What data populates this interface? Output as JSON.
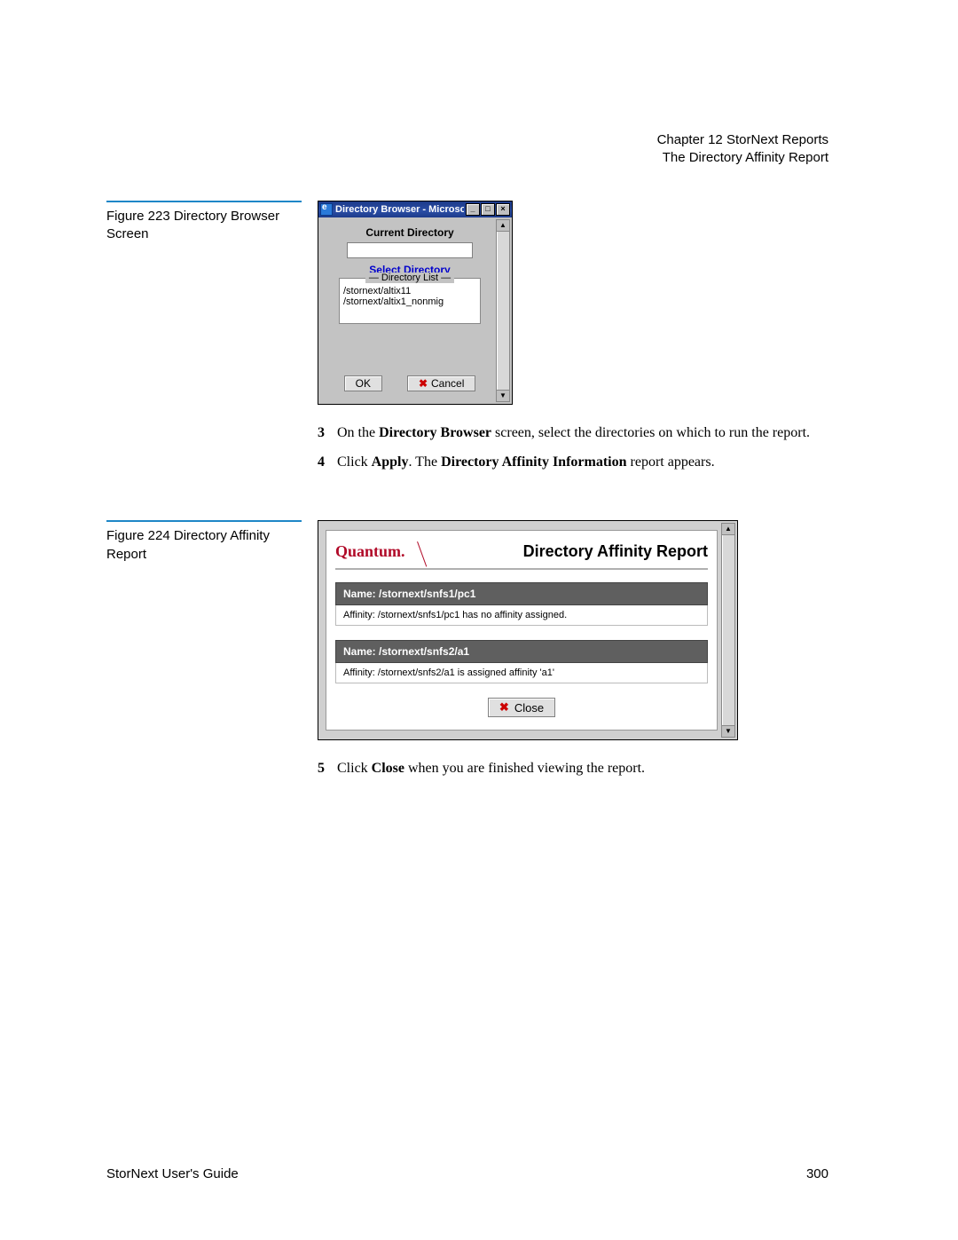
{
  "header": {
    "chapter": "Chapter 12  StorNext Reports",
    "section": "The Directory Affinity Report"
  },
  "figure1": {
    "caption": "Figure 223  Directory Browser Screen",
    "window_title": "Directory Browser - Microsoft Int...",
    "current_dir_label": "Current Directory",
    "select_dir_label": "Select Directory",
    "list_legend": "Directory List",
    "items": [
      "/stornext/altix11",
      "/stornext/altix1_nonmig"
    ],
    "ok_label": "OK",
    "cancel_label": "Cancel"
  },
  "steps_a": [
    {
      "num": "3",
      "pre": "On the ",
      "b1": "Directory Browser",
      "mid": " screen, select the directories on which to run the report."
    },
    {
      "num": "4",
      "pre": "Click ",
      "b1": "Apply",
      "mid": ". The ",
      "b2": "Directory Affinity Information",
      "post": " report appears."
    }
  ],
  "figure2": {
    "caption": "Figure 224  Directory Affinity Report",
    "brand": "Quantum.",
    "title": "Directory Affinity Report",
    "entries": [
      {
        "name": "Name: /stornext/snfs1/pc1",
        "detail": "Affinity: /stornext/snfs1/pc1 has no affinity assigned."
      },
      {
        "name": "Name: /stornext/snfs2/a1",
        "detail": "Affinity: /stornext/snfs2/a1 is assigned affinity 'a1'"
      }
    ],
    "close_label": "Close"
  },
  "steps_b": [
    {
      "num": "5",
      "pre": "Click ",
      "b1": "Close",
      "mid": " when you are finished viewing the report."
    }
  ],
  "footer": {
    "left": "StorNext User's Guide",
    "right": "300"
  }
}
